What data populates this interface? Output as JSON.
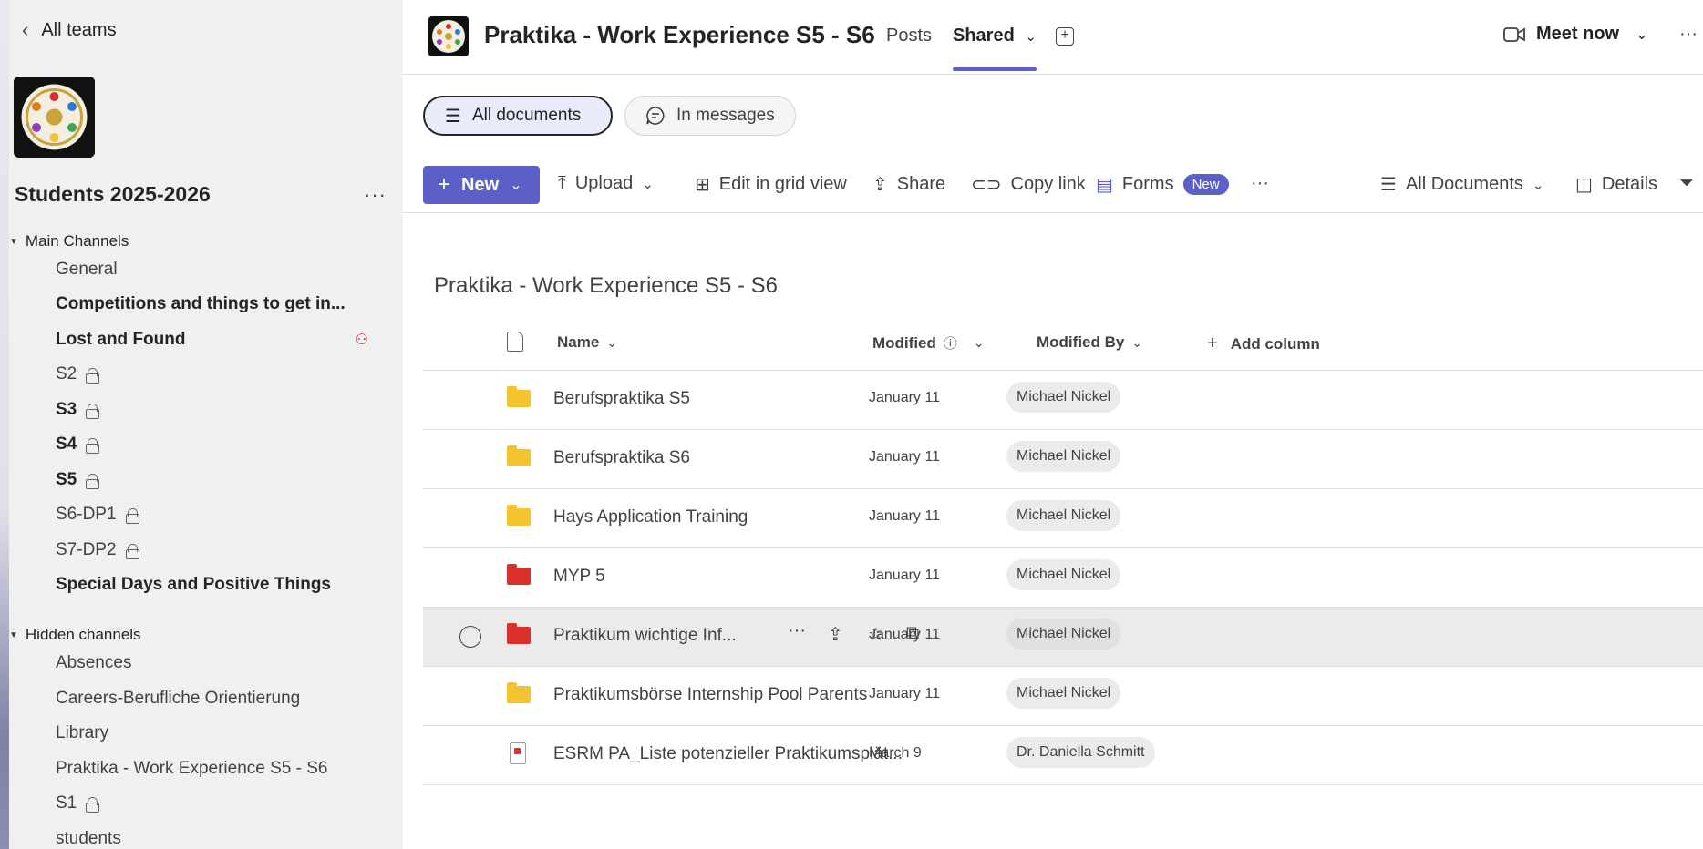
{
  "sidebar": {
    "back_label": "All teams",
    "team_name": "Students 2025-2026",
    "team_more": "···",
    "groups": [
      {
        "label": "Main Channels"
      },
      {
        "label": "Hidden channels"
      }
    ],
    "channels": [
      {
        "label": "General"
      },
      {
        "label": "Competitions and things to get in..."
      },
      {
        "label": "Lost and Found"
      },
      {
        "label": "S2"
      },
      {
        "label": "S3"
      },
      {
        "label": "S4"
      },
      {
        "label": "S5"
      },
      {
        "label": "S6-DP1"
      },
      {
        "label": "S7-DP2"
      },
      {
        "label": "Special Days and Positive Things"
      },
      {
        "label": "Absences"
      },
      {
        "label": "Careers-Berufliche Orientierung"
      },
      {
        "label": "Library"
      },
      {
        "label": "Praktika - Work Experience S5 - S6"
      },
      {
        "label": "S1"
      },
      {
        "label": "students"
      }
    ]
  },
  "header": {
    "channel_title": "Praktika - Work Experience S5 - S6",
    "tabs": [
      {
        "label": "Posts"
      },
      {
        "label": "Shared"
      }
    ],
    "meet_now": "Meet now",
    "more": "···"
  },
  "filters": {
    "all_documents": "All documents",
    "in_messages": "In messages"
  },
  "toolbar": {
    "new": "New",
    "upload": "Upload",
    "edit_grid": "Edit in grid view",
    "share": "Share",
    "copy_link": "Copy link",
    "forms": "Forms",
    "forms_badge": "New",
    "more": "···",
    "view": "All Documents",
    "details": "Details"
  },
  "library": {
    "title": "Praktika - Work Experience S5 - S6",
    "columns": {
      "name": "Name",
      "modified": "Modified",
      "modified_by": "Modified By",
      "add_column": "Add column"
    },
    "rows": [
      {
        "name": "Berufspraktika S5",
        "modified": "January 11",
        "by": "Michael Nickel"
      },
      {
        "name": "Berufspraktika S6",
        "modified": "January 11",
        "by": "Michael Nickel"
      },
      {
        "name": "Hays Application Training",
        "modified": "January 11",
        "by": "Michael Nickel"
      },
      {
        "name": "MYP 5",
        "modified": "January 11",
        "by": "Michael Nickel"
      },
      {
        "name": "Praktikum wichtige Inf...",
        "modified": "January 11",
        "by": "Michael Nickel"
      },
      {
        "name": "Praktikumsbörse Internship Pool Parents",
        "modified": "January 11",
        "by": "Michael Nickel"
      },
      {
        "name": "ESRM PA_Liste potenzieller Praktikumsplät...",
        "modified": "March 9",
        "by": "Dr. Daniella Schmitt"
      }
    ]
  },
  "colors": {
    "accent": "#5b5fc7",
    "folder_yellow": "#f4c430",
    "folder_red": "#d9302c"
  }
}
